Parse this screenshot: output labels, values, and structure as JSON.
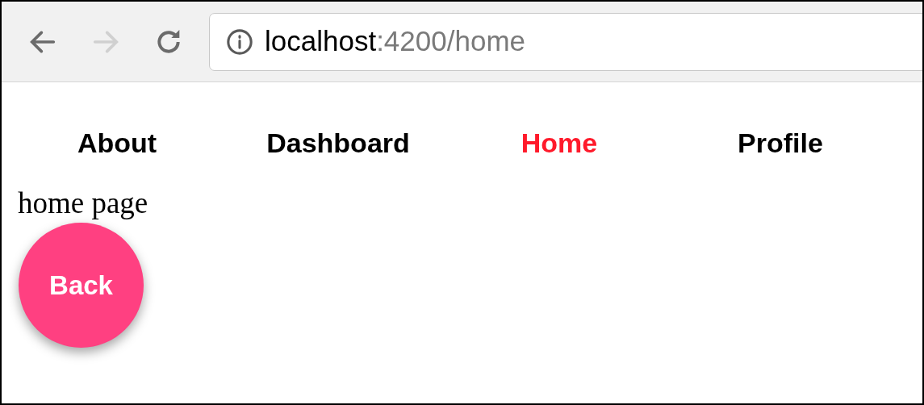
{
  "browser": {
    "back": {
      "disabled": false
    },
    "forward": {
      "disabled": true
    },
    "address": {
      "host": "localhost",
      "rest": ":4200/home"
    }
  },
  "nav": [
    {
      "label": "About",
      "selected": false
    },
    {
      "label": "Dashboard",
      "selected": false
    },
    {
      "label": "Home",
      "selected": true
    },
    {
      "label": "Profile",
      "selected": false
    }
  ],
  "page_text": "home page",
  "back_button": "Back"
}
